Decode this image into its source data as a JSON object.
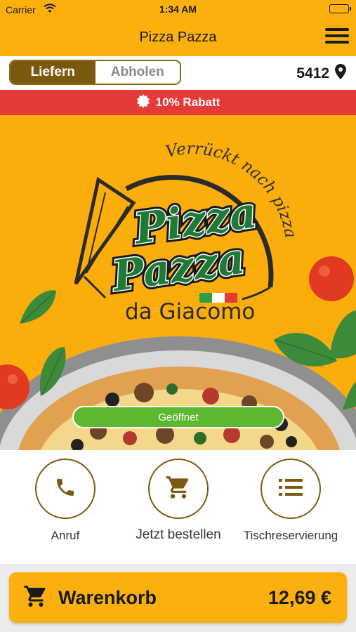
{
  "status_bar": {
    "carrier": "Carrier",
    "time": "1:34 AM"
  },
  "nav": {
    "title": "Pizza Pazza",
    "menu_icon": "hamburger-menu-icon"
  },
  "mode_toggle": {
    "options": [
      "Liefern",
      "Abholen"
    ],
    "selected": "Liefern"
  },
  "postcode": {
    "value": "5412",
    "icon": "location-pin-icon"
  },
  "promo": {
    "label": "10% Rabatt",
    "icon": "discount-badge-icon"
  },
  "hero": {
    "logo": {
      "slogan": "Verrückt nach pizza",
      "brand_line1": "Pizza",
      "brand_line2": "Pazza",
      "subtitle": "da Giacomo",
      "flag_colors": [
        "#2E9E3F",
        "#FFFFFF",
        "#E53A37"
      ]
    },
    "status": "Geöffnet"
  },
  "actions": [
    {
      "label": "Anruf",
      "icon": "phone-icon"
    },
    {
      "label": "Jetzt bestellen",
      "icon": "cart-icon"
    },
    {
      "label": "Tischreservierung",
      "icon": "list-icon"
    }
  ],
  "cart": {
    "label": "Warenkorb",
    "total": "12,69 €",
    "icon": "cart-icon"
  },
  "colors": {
    "brand": "#FBB00E",
    "accent_brown": "#7B5A10",
    "promo_red": "#E53A37",
    "open_green": "#5CB82E",
    "logo_green": "#1F7A34"
  }
}
